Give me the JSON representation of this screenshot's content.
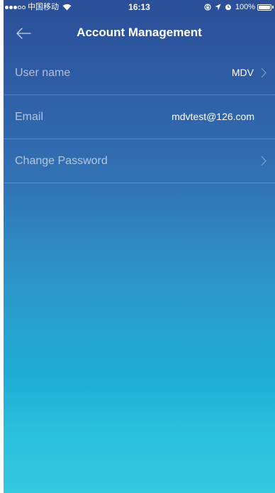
{
  "status_bar": {
    "carrier": "中国移动",
    "time": "16:13",
    "battery": "100%",
    "signal_bars_filled": 3,
    "signal_bars_total": 5
  },
  "nav": {
    "title": "Account Management",
    "back_icon": "arrow-left-icon"
  },
  "rows": [
    {
      "label": "User name",
      "value": "MDV",
      "chevron": true
    },
    {
      "label": "Email",
      "value": "mdvtest@126.com",
      "chevron": false
    },
    {
      "label": "Change Password",
      "value": "",
      "chevron": true
    }
  ],
  "colors": {
    "gradient_top": "#2b4f98",
    "gradient_bottom": "#36c8de",
    "text": "#ffffff"
  }
}
